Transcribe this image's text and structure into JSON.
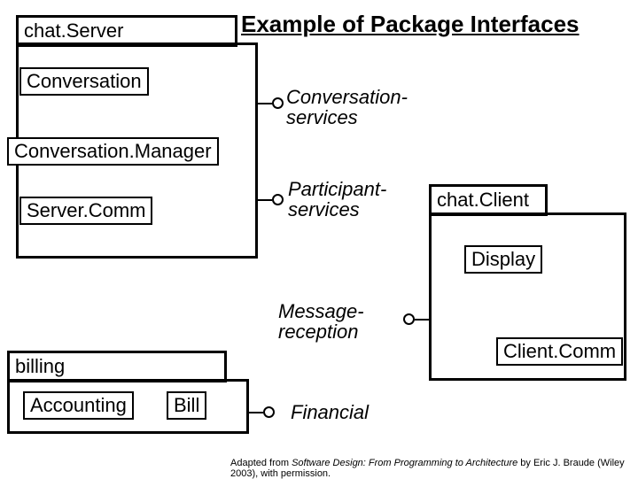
{
  "title": "Example of Package Interfaces",
  "packages": {
    "chatServer": {
      "tab": "chat.Server"
    },
    "chatClient": {
      "tab": "chat.Client"
    },
    "billing": {
      "tab": "billing"
    }
  },
  "classes": {
    "conversation": "Conversation",
    "conversationManager": "Conversation.Manager",
    "serverComm": "Server.Comm",
    "display": "Display",
    "clientComm": "Client.Comm",
    "accounting": "Accounting",
    "bill": "Bill"
  },
  "interfaces": {
    "conversationServices": "Conversation-\nservices",
    "participantServices": "Participant-\nservices",
    "messageReception": "Message-\nreception",
    "financial": "Financial"
  },
  "credit": {
    "pre": "Adapted from ",
    "ital": "Software Design: From Programming to Architecture",
    "post": " by Eric J. Braude (Wiley 2003), with permission."
  }
}
